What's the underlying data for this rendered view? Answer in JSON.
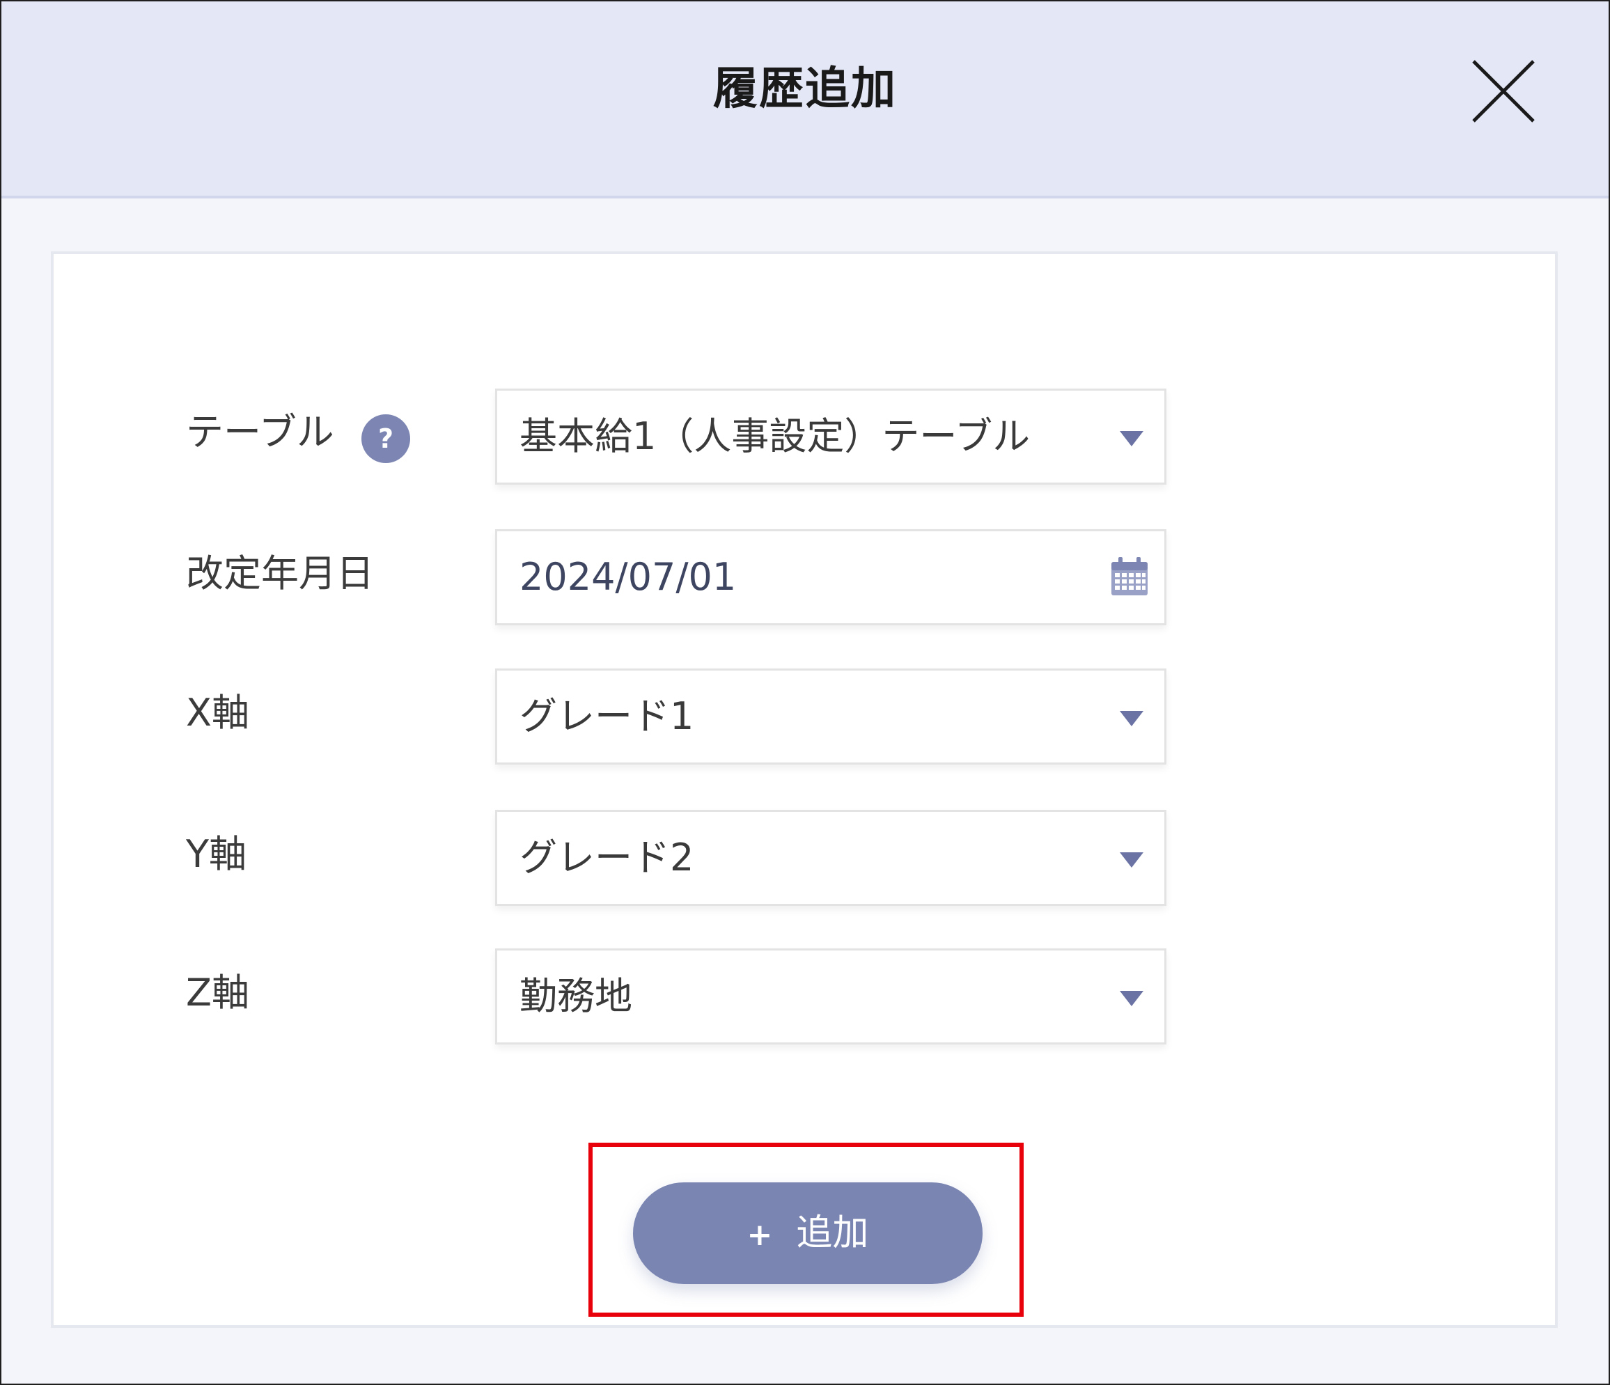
{
  "dialog": {
    "title": "履歴追加",
    "close_icon": "close-icon"
  },
  "form": {
    "table": {
      "label": "テーブル",
      "help_icon": "question-icon",
      "help_text": "?",
      "value": "基本給1（人事設定）テーブル",
      "icon": "chevron-down-icon"
    },
    "revision_date": {
      "label": "改定年月日",
      "value": "2024/07/01",
      "icon": "calendar-icon"
    },
    "x_axis": {
      "label": "X軸",
      "value": "グレード1",
      "icon": "chevron-down-icon"
    },
    "y_axis": {
      "label": "Y軸",
      "value": "グレード2",
      "icon": "chevron-down-icon"
    },
    "z_axis": {
      "label": "Z軸",
      "value": "勤務地",
      "icon": "chevron-down-icon"
    }
  },
  "actions": {
    "add_plus": "+",
    "add_label": "追加"
  },
  "colors": {
    "header_bg": "#e4e7f6",
    "accent": "#7b85b2",
    "highlight": "#e8000b"
  }
}
